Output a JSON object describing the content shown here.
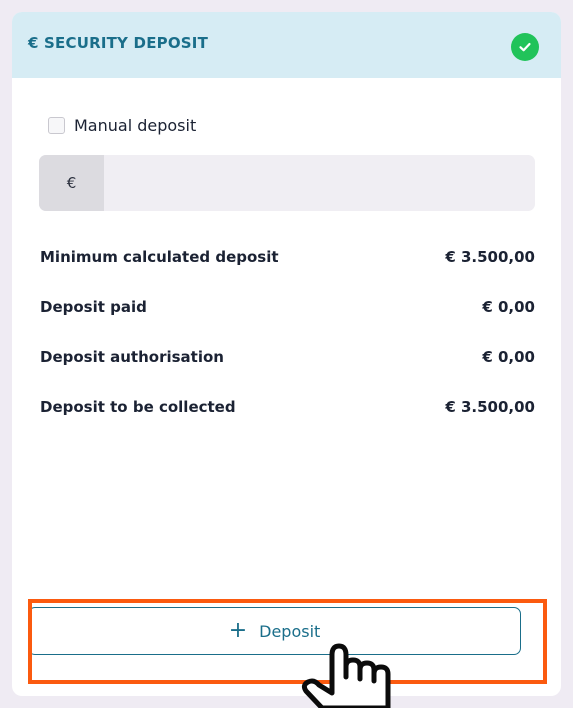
{
  "header": {
    "title": "€ SECURITY DEPOSIT",
    "status_icon": "check-circle-icon",
    "status_color": "#21c35a"
  },
  "manual_deposit": {
    "label": "Manual deposit",
    "checked": false
  },
  "amount_input": {
    "currency_symbol": "€",
    "value": "",
    "placeholder": ""
  },
  "summary": [
    {
      "label": "Minimum calculated deposit",
      "value": "€ 3.500,00"
    },
    {
      "label": "Deposit paid",
      "value": "€ 0,00"
    },
    {
      "label": "Deposit authorisation",
      "value": "€ 0,00"
    },
    {
      "label": "Deposit to be collected",
      "value": "€ 3.500,00"
    }
  ],
  "deposit_button": {
    "icon": "plus-icon",
    "label": "Deposit"
  },
  "colors": {
    "accent": "#1a6e8a",
    "header_bg": "#d6ecf4",
    "highlight": "#fb5a0f"
  },
  "cursor": "hand-pointer-icon"
}
